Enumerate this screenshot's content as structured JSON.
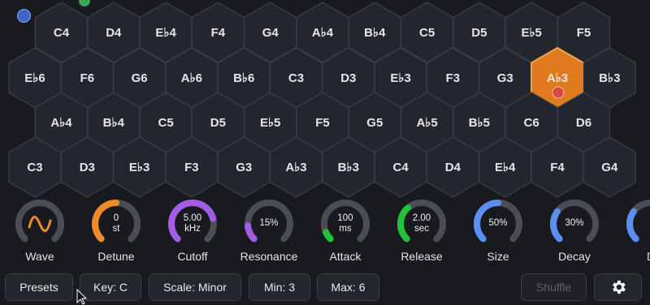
{
  "hex_rows": [
    [
      "C4",
      "D4",
      "E♭4",
      "F4",
      "G4",
      "A♭4",
      "B♭4",
      "C5",
      "D5",
      "E♭5",
      "F5"
    ],
    [
      "E♭6",
      "F6",
      "G6",
      "A♭6",
      "B♭6",
      "C3",
      "D3",
      "E♭3",
      "F3",
      "G3",
      "A♭3",
      "B♭3"
    ],
    [
      "A♭4",
      "B♭4",
      "C5",
      "D5",
      "E♭5",
      "F5",
      "G5",
      "A♭5",
      "B♭5",
      "C6",
      "D6"
    ],
    [
      "C3",
      "D3",
      "E♭3",
      "F3",
      "G3",
      "A♭3",
      "B♭3",
      "C4",
      "D4",
      "E♭4",
      "F4",
      "G4"
    ]
  ],
  "active_key": {
    "row": 1,
    "col": 10
  },
  "colors": {
    "hex_fill": "#23262c",
    "hex_stroke": "#3b3e46",
    "active_fill": "#e07b1f",
    "active_stroke": "#f3a24c",
    "touch_red": "#d9493f",
    "touch_blue": "#3e63c9",
    "touch_green": "#3ea356"
  },
  "knobs": [
    {
      "name": "Wave",
      "value": "",
      "icon": "sine-wave-icon",
      "level": 0,
      "color": "#f08a28"
    },
    {
      "name": "Detune",
      "value": "0\nst",
      "level": 0.5,
      "color": "#f08a28"
    },
    {
      "name": "Cutoff",
      "value": "5.00\nkHz",
      "level": 0.78,
      "color": "#a45be8"
    },
    {
      "name": "Resonance",
      "value": "15%",
      "level": 0.15,
      "color": "#a45be8"
    },
    {
      "name": "Attack",
      "value": "100\nms",
      "level": 0.08,
      "color": "#23c23a"
    },
    {
      "name": "Release",
      "value": "2.00\nsec",
      "level": 0.35,
      "color": "#23c23a"
    },
    {
      "name": "Size",
      "value": "50%",
      "level": 0.5,
      "color": "#5b8ef0"
    },
    {
      "name": "Decay",
      "value": "30%",
      "level": 0.3,
      "color": "#5b8ef0"
    },
    {
      "name": "D",
      "value": "",
      "level": 0.3,
      "color": "#5b8ef0"
    }
  ],
  "buttons": {
    "presets": "Presets",
    "key": "Key: C",
    "scale": "Scale: Minor",
    "min": "Min: 3",
    "max": "Max: 6",
    "shuffle": "Shuffle",
    "settings_icon": "gear-icon"
  }
}
